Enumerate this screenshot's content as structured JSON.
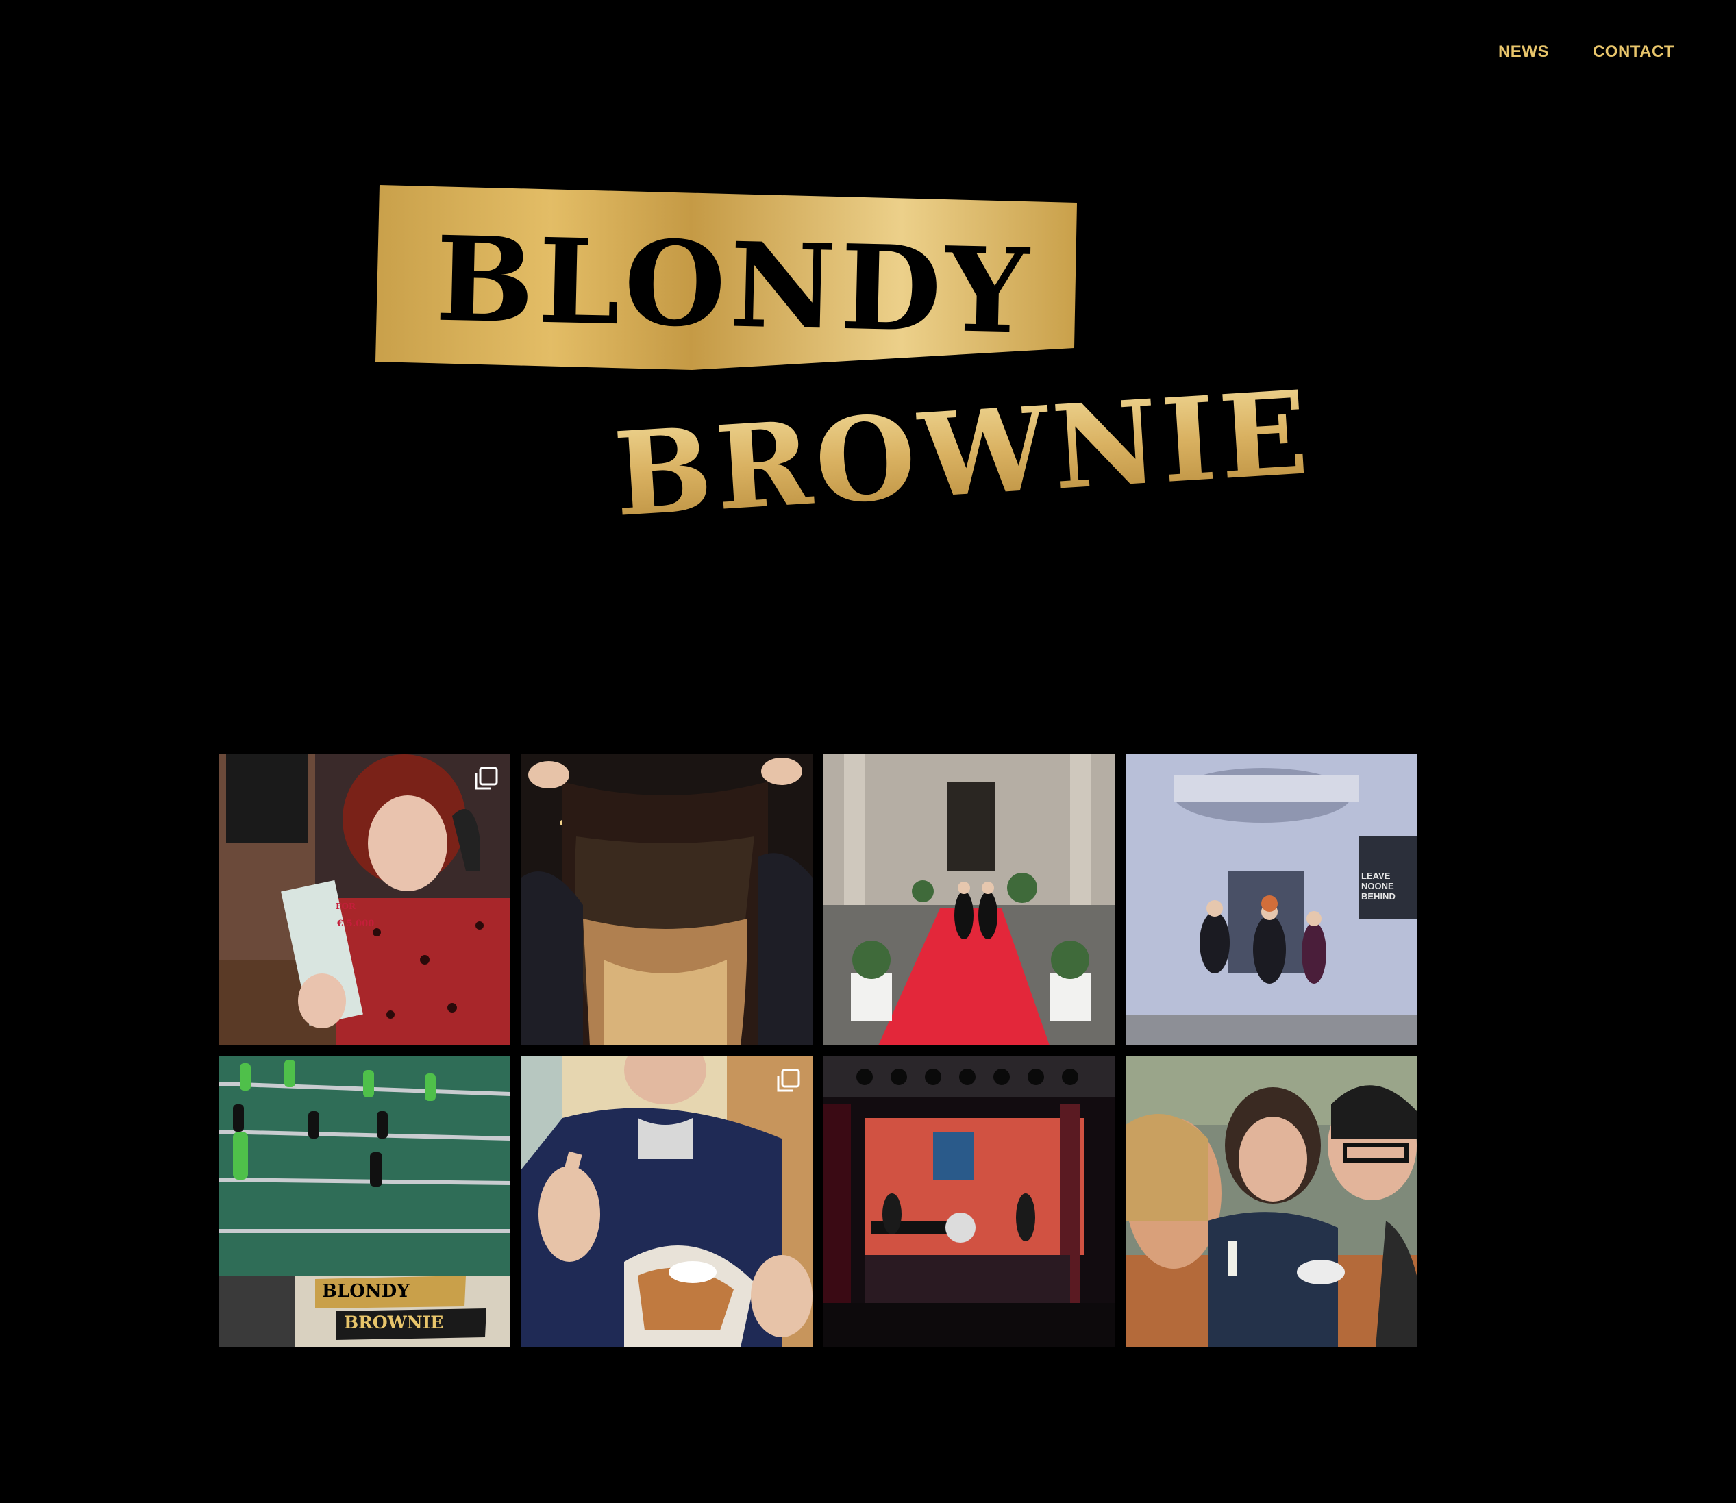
{
  "nav": {
    "items": [
      {
        "label": "NEWS"
      },
      {
        "label": "CONTACT"
      }
    ]
  },
  "logo": {
    "line1": "BLONDY",
    "line2": "BROWNIE"
  },
  "colors": {
    "background": "#000000",
    "accent_gold": "#e8c56b",
    "gold_dark": "#c9a04a",
    "gold_light": "#f0d48f"
  },
  "instagram_grid": {
    "tiles": [
      {
        "scene": "woman-headphones-scratch-ticket",
        "multi": true,
        "ticket_text": "€ 5.000",
        "ticket_badge": "FOR"
      },
      {
        "scene": "hair-flip-party",
        "multi": false
      },
      {
        "scene": "red-carpet-dance",
        "multi": false
      },
      {
        "scene": "building-jump",
        "multi": false,
        "window_text": "LEAVE NOONE BEHIND"
      },
      {
        "scene": "foosball-table",
        "multi": false,
        "sticker_line1": "BLONDY",
        "sticker_line2": "BROWNIE"
      },
      {
        "scene": "man-thumbs-up-food",
        "multi": true
      },
      {
        "scene": "band-on-stage",
        "multi": false
      },
      {
        "scene": "selfie-three-faces",
        "multi": false
      }
    ]
  }
}
